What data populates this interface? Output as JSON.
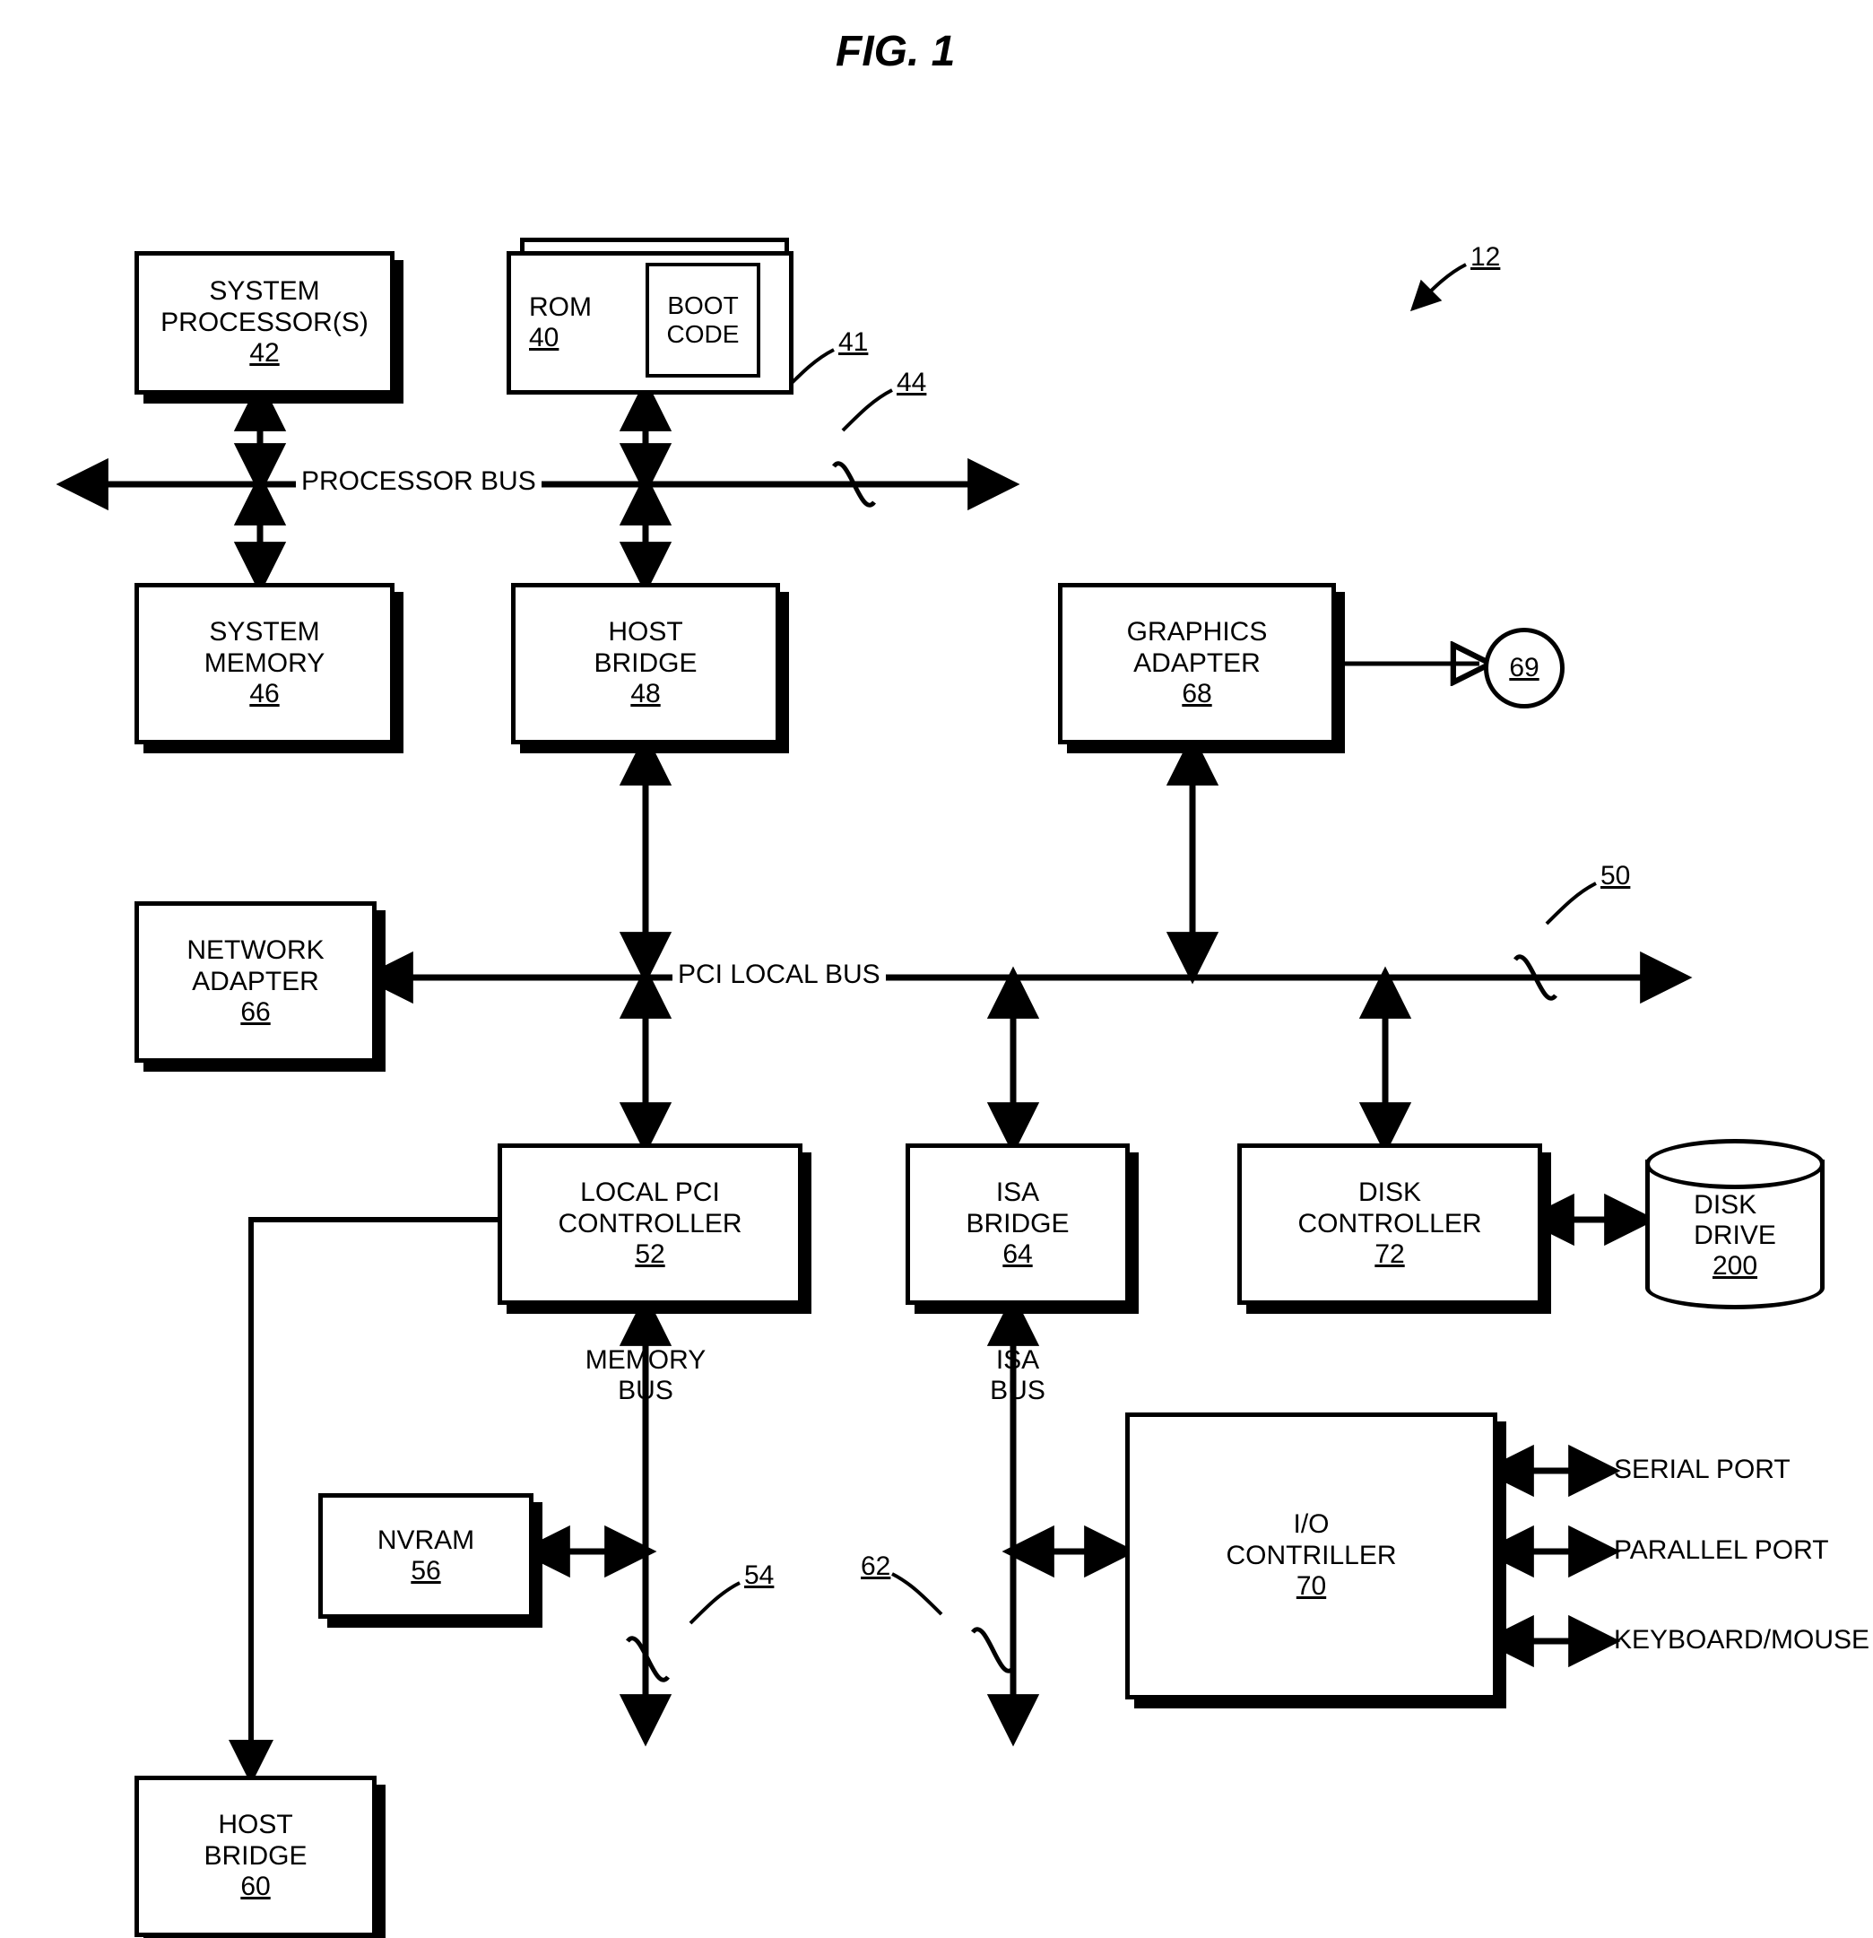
{
  "figure": {
    "title": "FIG. 1",
    "main_ref": "12"
  },
  "blocks": {
    "system_processors": {
      "label": "SYSTEM\nPROCESSOR(S)",
      "ref": "42"
    },
    "rom": {
      "label": "ROM",
      "ref": "40",
      "back_ref": "41"
    },
    "boot_code": {
      "label": "BOOT\nCODE"
    },
    "system_memory": {
      "label": "SYSTEM\nMEMORY",
      "ref": "46"
    },
    "host_bridge": {
      "label": "HOST\nBRIDGE",
      "ref": "48"
    },
    "graphics_adapter": {
      "label": "GRAPHICS\nADAPTER",
      "ref": "68"
    },
    "display": {
      "ref": "69"
    },
    "network_adapter": {
      "label": "NETWORK\nADAPTER",
      "ref": "66"
    },
    "local_pci": {
      "label": "LOCAL PCI\nCONTROLLER",
      "ref": "52"
    },
    "isa_bridge": {
      "label": "ISA\nBRIDGE",
      "ref": "64"
    },
    "disk_controller": {
      "label": "DISK\nCONTROLLER",
      "ref": "72"
    },
    "disk_drive": {
      "label": "DISK\nDRIVE",
      "ref": "200"
    },
    "nvram": {
      "label": "NVRAM",
      "ref": "56"
    },
    "io_controller": {
      "label": "I/O\nCONTRILLER",
      "ref": "70"
    },
    "host_bridge2": {
      "label": "HOST\nBRIDGE",
      "ref": "60"
    }
  },
  "buses": {
    "processor_bus": {
      "label": "PROCESSOR BUS",
      "ref": "44"
    },
    "pci_local_bus": {
      "label": "PCI LOCAL BUS",
      "ref": "50"
    },
    "memory_bus": {
      "label": "MEMORY\nBUS",
      "ref": "54"
    },
    "isa_bus": {
      "label": "ISA\nBUS",
      "ref": "62"
    }
  },
  "io_ports": {
    "serial": "SERIAL PORT",
    "parallel": "PARALLEL PORT",
    "keyboard": "KEYBOARD/MOUSE"
  }
}
